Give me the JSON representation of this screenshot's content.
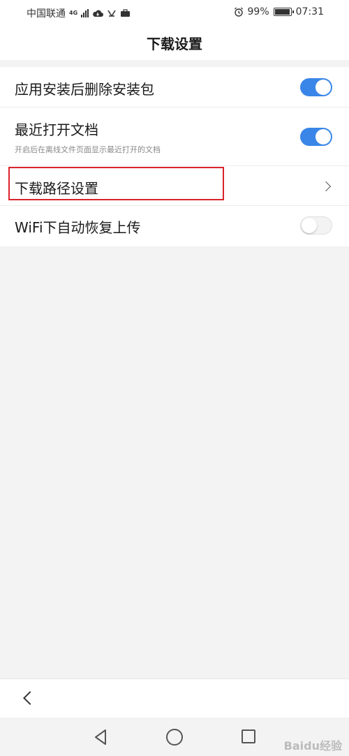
{
  "status_bar": {
    "carrier": "中国联通",
    "network": "4G",
    "battery_percent": "99%",
    "time": "07:31",
    "battery_level": 0.99,
    "icons": [
      "signal-icon",
      "cloud-icon",
      "app-icon",
      "briefcase-icon",
      "alarm-icon",
      "battery-icon"
    ]
  },
  "header": {
    "title": "下载设置"
  },
  "settings": {
    "items": [
      {
        "title": "应用安装后删除安装包",
        "type": "toggle",
        "on": true
      },
      {
        "title": "最近打开文档",
        "subtitle": "开启后在离线文件页面显示最近打开的文档",
        "type": "toggle",
        "on": true
      },
      {
        "title": "下载路径设置",
        "type": "link"
      },
      {
        "title": "WiFi下自动恢复上传",
        "type": "toggle",
        "on": false
      }
    ]
  },
  "watermark": "Baidu经验",
  "colors": {
    "accent": "#3a86e8",
    "highlight": "#d9232a",
    "background": "#f3f3f3"
  }
}
